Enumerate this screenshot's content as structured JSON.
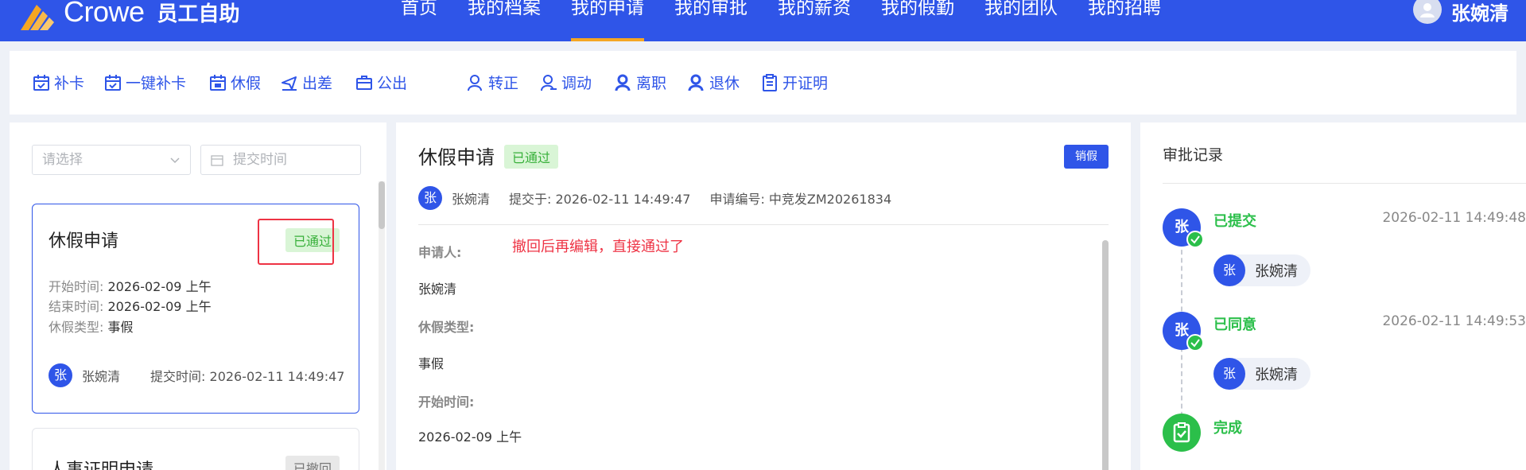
{
  "header": {
    "brand": "Crowe",
    "app_name": "员工自助",
    "nav": [
      "首页",
      "我的档案",
      "我的申请",
      "我的审批",
      "我的薪资",
      "我的假勤",
      "我的团队",
      "我的招聘"
    ],
    "active_nav": "我的申请",
    "user_name": "张婉清"
  },
  "toolbar": {
    "items": [
      "补卡",
      "一键补卡",
      "休假",
      "出差",
      "公出",
      "转正",
      "调动",
      "离职",
      "退休",
      "开证明"
    ]
  },
  "filters": {
    "select_placeholder": "请选择",
    "date_placeholder": "提交时间"
  },
  "list": {
    "cards": [
      {
        "title": "休假申请",
        "status": "已通过",
        "start_label": "开始时间:",
        "start": "2026-02-09 上午",
        "end_label": "结束时间:",
        "end": "2026-02-09 上午",
        "type_label": "休假类型:",
        "type": "事假",
        "avatar": "张",
        "user": "张婉清",
        "submit_label": "提交时间:",
        "submit_time": "2026-02-11 14:49:47"
      },
      {
        "title": "人事证明申请",
        "status": "已撤回"
      }
    ]
  },
  "detail": {
    "title": "休假申请",
    "status": "已通过",
    "cancel_button": "销假",
    "avatar": "张",
    "applicant_name": "张婉清",
    "submitted": "提交于: 2026-02-11 14:49:47",
    "application_no": "申请编号: 中竞发ZM20261834",
    "annotation": "撤回后再编辑，直接通过了",
    "fields": [
      {
        "label": "申请人:",
        "value": "张婉清"
      },
      {
        "label": "休假类型:",
        "value": "事假"
      },
      {
        "label": "开始时间:",
        "value": "2026-02-09 上午"
      }
    ]
  },
  "approval": {
    "title": "审批记录",
    "records": [
      {
        "node": "张",
        "status": "已提交",
        "time": "2026-02-11 14:49:48",
        "avatar": "张",
        "person": "张婉清"
      },
      {
        "node": "张",
        "status": "已同意",
        "time": "2026-02-11 14:49:53",
        "avatar": "张",
        "person": "张婉清"
      }
    ],
    "final_status": "完成"
  },
  "colors": {
    "primary": "#2f55e8",
    "nav_active_underline": "#f5a623",
    "success": "#2bbf4a",
    "annotation_red": "#ee3344"
  }
}
